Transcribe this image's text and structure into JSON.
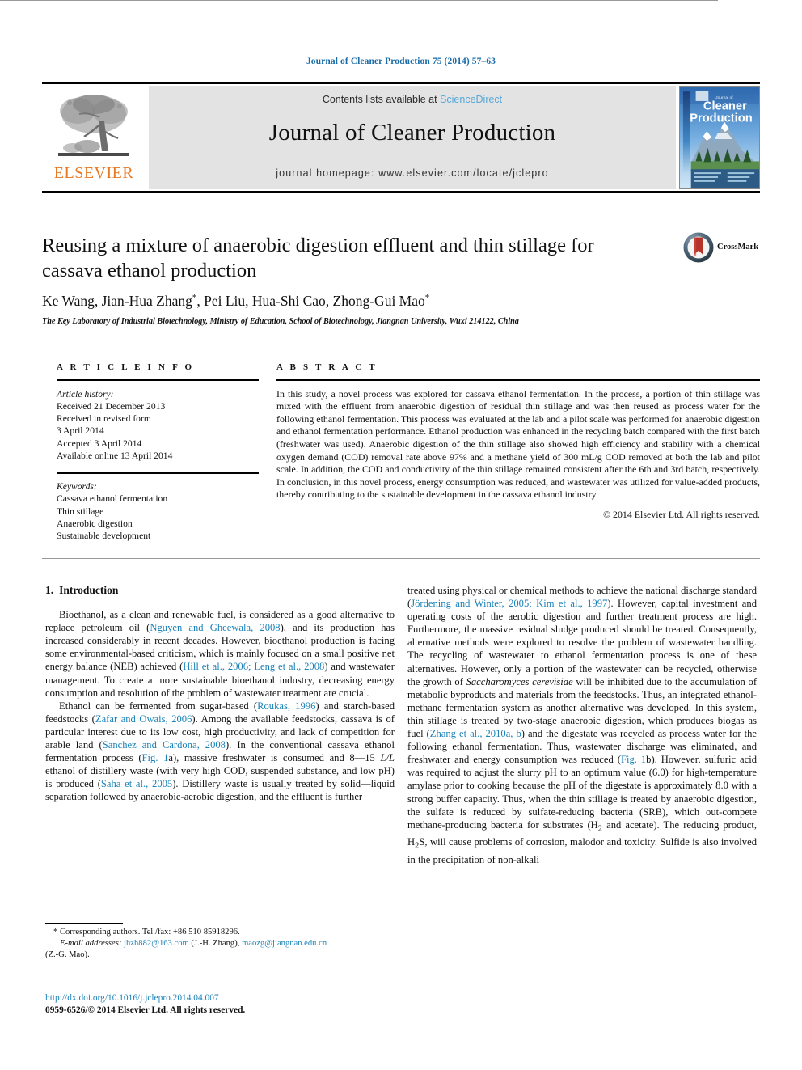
{
  "running_head": "Journal of Cleaner Production 75 (2014) 57–63",
  "masthead": {
    "publisher_name": "ELSEVIER",
    "contents_prefix": "Contents lists available at ",
    "contents_link": "ScienceDirect",
    "journal_title": "Journal of Cleaner Production",
    "homepage_line": "journal homepage: www.elsevier.com/locate/jclepro",
    "cover_line1": "Journal of",
    "cover_line2": "Cleaner",
    "cover_line3": "Production"
  },
  "article": {
    "title": "Reusing a mixture of anaerobic digestion effluent and thin stillage for cassava ethanol production",
    "authors_html": "Ke Wang, Jian-Hua Zhang<sup>*</sup>, Pei Liu, Hua-Shi Cao, Zhong-Gui Mao<sup>*</sup>",
    "affiliation": "The Key Laboratory of Industrial Biotechnology, Ministry of Education, School of Biotechnology, Jiangnan University, Wuxi 214122, China",
    "crossmark_label": "CrossMark"
  },
  "article_info": {
    "heading": "A R T I C L E  I N F O",
    "history_label": "Article history:",
    "history": [
      "Received 21 December 2013",
      "Received in revised form",
      "3 April 2014",
      "Accepted 3 April 2014",
      "Available online 13 April 2014"
    ],
    "keywords_label": "Keywords:",
    "keywords": [
      "Cassava ethanol fermentation",
      "Thin stillage",
      "Anaerobic digestion",
      "Sustainable development"
    ]
  },
  "abstract": {
    "heading": "A B S T R A C T",
    "text": "In this study, a novel process was explored for cassava ethanol fermentation. In the process, a portion of thin stillage was mixed with the effluent from anaerobic digestion of residual thin stillage and was then reused as process water for the following ethanol fermentation. This process was evaluated at the lab and a pilot scale was performed for anaerobic digestion and ethanol fermentation performance. Ethanol production was enhanced in the recycling batch compared with the first batch (freshwater was used). Anaerobic digestion of the thin stillage also showed high efficiency and stability with a chemical oxygen demand (COD) removal rate above 97% and a methane yield of 300 mL/g COD removed at both the lab and pilot scale. In addition, the COD and conductivity of the thin stillage remained consistent after the 6th and 3rd batch, respectively. In conclusion, in this novel process, energy consumption was reduced, and wastewater was utilized for value-added products, thereby contributing to the sustainable development in the cassava ethanol industry.",
    "copyright": "© 2014 Elsevier Ltd. All rights reserved."
  },
  "introduction": {
    "number": "1.",
    "heading": "Introduction",
    "left_paragraphs": [
      "Bioethanol, as a clean and renewable fuel, is considered as a good alternative to replace petroleum oil (<span class=\"cit\">Nguyen and Gheewala, 2008</span>), and its production has increased considerably in recent decades. However, bioethanol production is facing some environmental-based criticism, which is mainly focused on a small positive net energy balance (NEB) achieved (<span class=\"cit\">Hill et al., 2006; Leng et al., 2008</span>) and wastewater management. To create a more sustainable bioethanol industry, decreasing energy consumption and resolution of the problem of wastewater treatment are crucial.",
      "Ethanol can be fermented from sugar-based (<span class=\"cit\">Roukas, 1996</span>) and starch-based feedstocks (<span class=\"cit\">Zafar and Owais, 2006</span>). Among the available feedstocks, cassava is of particular interest due to its low cost, high productivity, and lack of competition for arable land (<span class=\"cit\">Sanchez and Cardona, 2008</span>). In the conventional cassava ethanol fermentation process (<span class=\"cit\">Fig. 1</span>a), massive freshwater is consumed and 8&#8212;15 <span class=\"ital\">L/L</span> ethanol of distillery waste (with very high COD, suspended substance, and low pH) is produced (<span class=\"cit\">Saha et al., 2005</span>). Distillery waste is usually treated by solid&#8212;liquid separation followed by anaerobic-aerobic digestion, and the effluent is further"
    ],
    "right_paragraphs": [
      "treated using physical or chemical methods to achieve the national discharge standard (<span class=\"cit\">Jördening and Winter, 2005; Kim et al., 1997</span>). However, capital investment and operating costs of the aerobic digestion and further treatment process are high. Furthermore, the massive residual sludge produced should be treated. Consequently, alternative methods were explored to resolve the problem of wastewater handling. The recycling of wastewater to ethanol fermentation process is one of these alternatives. However, only a portion of the wastewater can be recycled, otherwise the growth of <span class=\"ital\">Saccharomyces cerevisiae</span> will be inhibited due to the accumulation of metabolic byproducts and materials from the feedstocks. Thus, an integrated ethanol-methane fermentation system as another alternative was developed. In this system, thin stillage is treated by two-stage anaerobic digestion, which produces biogas as fuel (<span class=\"cit\">Zhang et al., 2010a, b</span>) and the digestate was recycled as process water for the following ethanol fermentation. Thus, wastewater discharge was eliminated, and freshwater and energy consumption was reduced (<span class=\"cit\">Fig. 1</span>b). However, sulfuric acid was required to adjust the slurry pH to an optimum value (6.0) for high-temperature amylase prior to cooking because the pH of the digestate is approximately 8.0 with a strong buffer capacity. Thus, when the thin stillage is treated by anaerobic digestion, the sulfate is reduced by sulfate-reducing bacteria (SRB), which out-compete methane-producing bacteria for substrates (H<sub>2</sub> and acetate). The reducing product, H<sub>2</sub>S, will cause problems of corrosion, malodor and toxicity. Sulfide is also involved in the precipitation of non-alkali"
    ]
  },
  "footnote": {
    "corresponding": "* Corresponding authors. Tel./fax: +86 510 85918296.",
    "email_label": "E-mail addresses:",
    "email1": "jhzh882@163.com",
    "email1_owner": "(J.-H. Zhang),",
    "email2": "maozg@jiangnan.edu.cn",
    "email2_owner": "(Z.-G. Mao)."
  },
  "doi_block": {
    "doi": "http://dx.doi.org/10.1016/j.jclepro.2014.04.007",
    "issn_line": "0959-6526/© 2014 Elsevier Ltd. All rights reserved."
  },
  "colors": {
    "link_blue": "#1a82b8",
    "header_blue": "#1a6ca8",
    "elsevier_orange": "#E87722",
    "masthead_gray": "#e3e3e3"
  }
}
